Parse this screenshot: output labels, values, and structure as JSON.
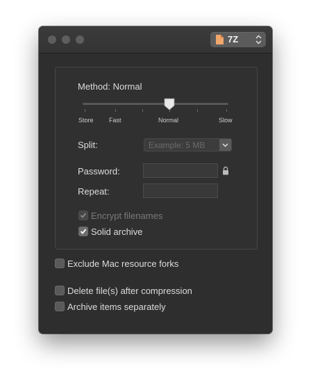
{
  "window": {
    "format_popup": {
      "value": "7Z",
      "options": [
        "7Z"
      ]
    }
  },
  "compression": {
    "method_label": "Method: Normal",
    "level": "Normal",
    "level_index": 3,
    "level_count": 7,
    "tick_labels": [
      "Store",
      "Fast",
      "Normal",
      "Slow"
    ]
  },
  "split": {
    "label": "Split:",
    "placeholder": "Example: 5 MB"
  },
  "password": {
    "label": "Password:",
    "value": ""
  },
  "repeat": {
    "label": "Repeat:",
    "value": ""
  },
  "options": {
    "encrypt_filenames": {
      "label": "Encrypt filenames",
      "checked": true,
      "enabled": false
    },
    "solid_archive": {
      "label": "Solid archive",
      "checked": true,
      "enabled": true
    }
  },
  "extra": {
    "exclude_forks": {
      "label": "Exclude Mac resource forks",
      "checked": false
    },
    "delete_after": {
      "label": "Delete file(s) after compression",
      "checked": false
    },
    "separately": {
      "label": "Archive items separately",
      "checked": false
    }
  },
  "colors": {
    "window_bg": "#2e2e2e",
    "titlebar": "#383838",
    "text": "#dcdcdc",
    "doc_icon": "#f0a56a"
  }
}
